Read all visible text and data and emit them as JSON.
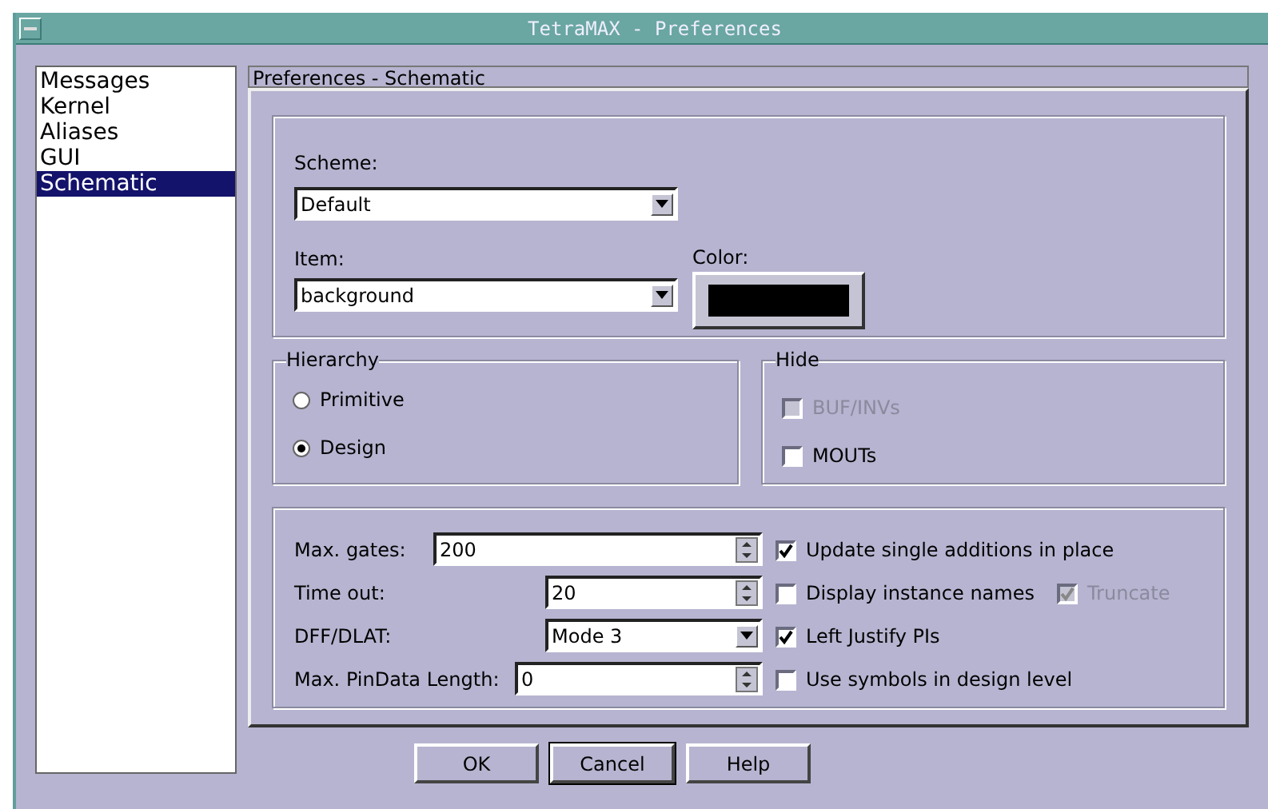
{
  "window": {
    "title": "TetraMAX - Preferences"
  },
  "sidebar": {
    "items": [
      {
        "label": "Messages",
        "selected": false
      },
      {
        "label": "Kernel",
        "selected": false
      },
      {
        "label": "Aliases",
        "selected": false
      },
      {
        "label": "GUI",
        "selected": false
      },
      {
        "label": "Schematic",
        "selected": true
      }
    ]
  },
  "panel": {
    "title": "Preferences - Schematic"
  },
  "scheme": {
    "label": "Scheme:",
    "value": "Default"
  },
  "item": {
    "label": "Item:",
    "value": "background"
  },
  "color": {
    "label": "Color:",
    "color": "#000000"
  },
  "hierarchy": {
    "title": "Hierarchy",
    "options": [
      {
        "label": "Primitive",
        "selected": false
      },
      {
        "label": "Design",
        "selected": true
      }
    ]
  },
  "hide": {
    "title": "Hide",
    "options": [
      {
        "label": "BUF/INVs",
        "checked": false,
        "disabled": true
      },
      {
        "label": "MOUTs",
        "checked": false,
        "disabled": false
      }
    ]
  },
  "fields": [
    {
      "label": "Max. gates:",
      "value": "200",
      "kind": "spin"
    },
    {
      "label": "Time out:",
      "value": "20",
      "kind": "spin"
    },
    {
      "label": "DFF/DLAT:",
      "value": "Mode 3",
      "kind": "dropdown"
    },
    {
      "label": "Max. PinData Length:",
      "value": "0",
      "kind": "spin"
    }
  ],
  "options": [
    {
      "label": "Update single additions in place",
      "checked": true,
      "disabled": false
    },
    {
      "label": "Display instance names",
      "checked": false,
      "disabled": false,
      "extra": {
        "label": "Truncate",
        "checked": true,
        "disabled": true
      }
    },
    {
      "label": "Left Justify PIs",
      "checked": true,
      "disabled": false
    },
    {
      "label": "Use symbols in design level",
      "checked": false,
      "disabled": false
    }
  ],
  "buttons": [
    {
      "label": "OK",
      "focused": false
    },
    {
      "label": "Cancel",
      "focused": true
    },
    {
      "label": "Help",
      "focused": false
    }
  ]
}
